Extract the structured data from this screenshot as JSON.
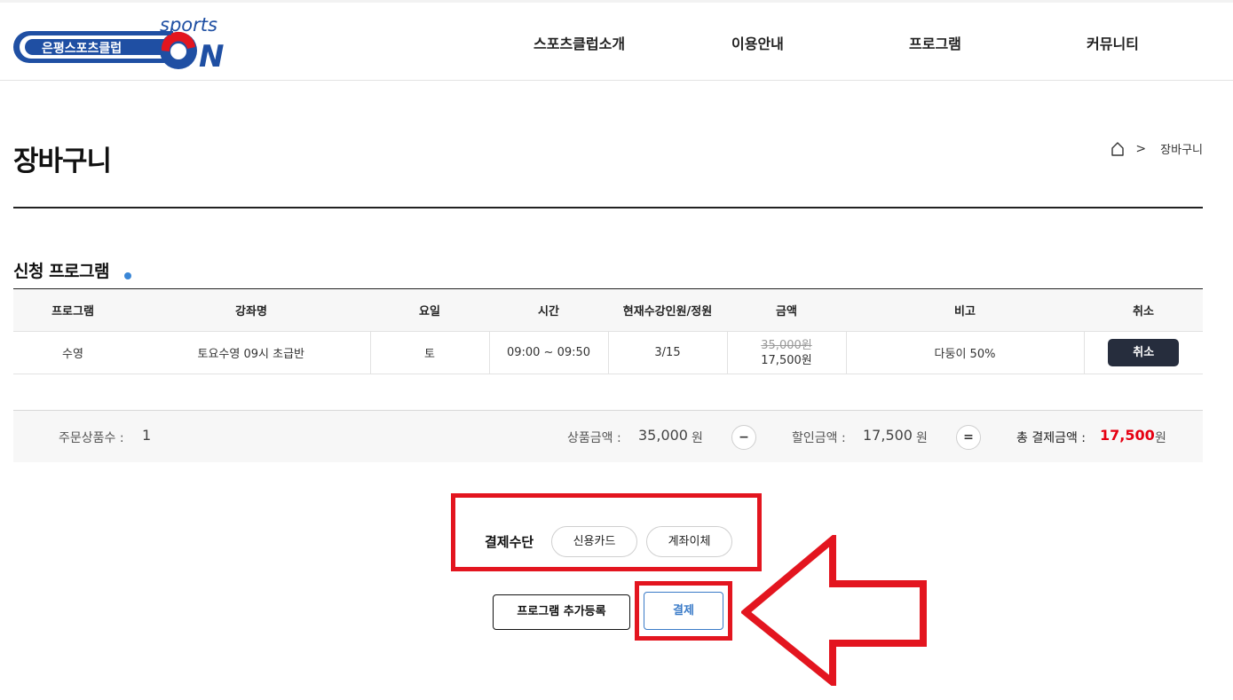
{
  "header": {
    "logo": {
      "brand_text": "은평스포츠클럽",
      "sports_text": "sports",
      "on_text": "ON"
    },
    "nav": [
      "스포츠클럽소개",
      "이용안내",
      "프로그램",
      "커뮤니티"
    ]
  },
  "page": {
    "title": "장바구니",
    "breadcrumb_current": "장바구니",
    "breadcrumb_sep": ">"
  },
  "section": {
    "title": "신청 프로그램"
  },
  "table": {
    "headers": [
      "프로그램",
      "강좌명",
      "요일",
      "시간",
      "현재수강인원/정원",
      "금액",
      "비고",
      "취소"
    ],
    "rows": [
      {
        "program": "수영",
        "course": "토요수영 09시 초급반",
        "day": "토",
        "time": "09:00 ~ 09:50",
        "enrollment": "3/15",
        "price_original": "35,000원",
        "price_final": "17,500원",
        "note": "다둥이 50%",
        "cancel_label": "취소"
      }
    ]
  },
  "summary": {
    "order_count_label": "주문상품수 :",
    "order_count": "1",
    "product_amount_label": "상품금액 :",
    "product_amount": "35,000",
    "discount_label": "할인금액 :",
    "discount_amount": "17,500",
    "total_label": "총 결제금액 :",
    "total_amount": "17,500",
    "unit": "원",
    "minus_op": "−",
    "equals_op": "="
  },
  "payment": {
    "label": "결제수단",
    "methods": [
      "신용카드",
      "계좌이체"
    ]
  },
  "actions": {
    "add_program_label": "프로그램 추가등록",
    "pay_label": "결제"
  },
  "colors": {
    "accent_dot": "#3a86d6",
    "total_red": "#e60012",
    "annotation_red": "#e3151f",
    "cancel_bg": "#262d3d",
    "pay_blue": "#3a7bc8"
  }
}
